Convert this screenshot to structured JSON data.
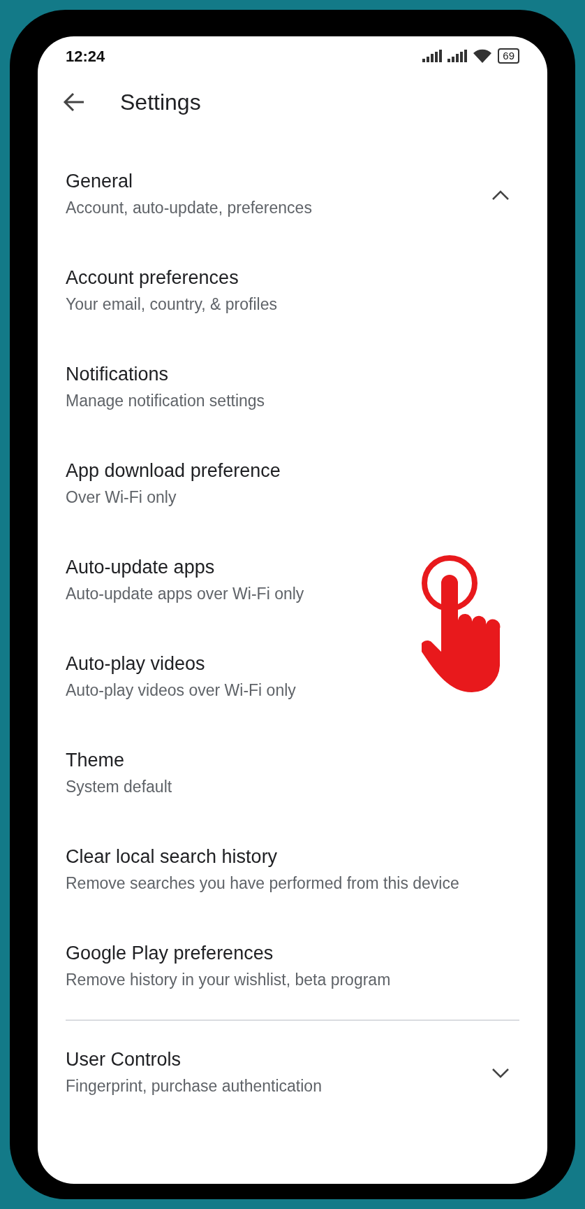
{
  "status_bar": {
    "time": "12:24",
    "battery": "69"
  },
  "header": {
    "title": "Settings"
  },
  "sections": [
    {
      "title": "General",
      "subtitle": "Account, auto-update, preferences",
      "expanded": true,
      "items": [
        {
          "title": "Account preferences",
          "subtitle": "Your email, country, & profiles"
        },
        {
          "title": "Notifications",
          "subtitle": "Manage notification settings"
        },
        {
          "title": "App download preference",
          "subtitle": "Over Wi-Fi only"
        },
        {
          "title": "Auto-update apps",
          "subtitle": "Auto-update apps over Wi-Fi only",
          "tapped": true
        },
        {
          "title": "Auto-play videos",
          "subtitle": "Auto-play videos over Wi-Fi only"
        },
        {
          "title": "Theme",
          "subtitle": "System default"
        },
        {
          "title": "Clear local search history",
          "subtitle": "Remove searches you have performed from this device"
        },
        {
          "title": "Google Play preferences",
          "subtitle": "Remove history in your wishlist, beta program"
        }
      ]
    },
    {
      "title": "User Controls",
      "subtitle": "Fingerprint, purchase authentication",
      "expanded": false
    }
  ]
}
